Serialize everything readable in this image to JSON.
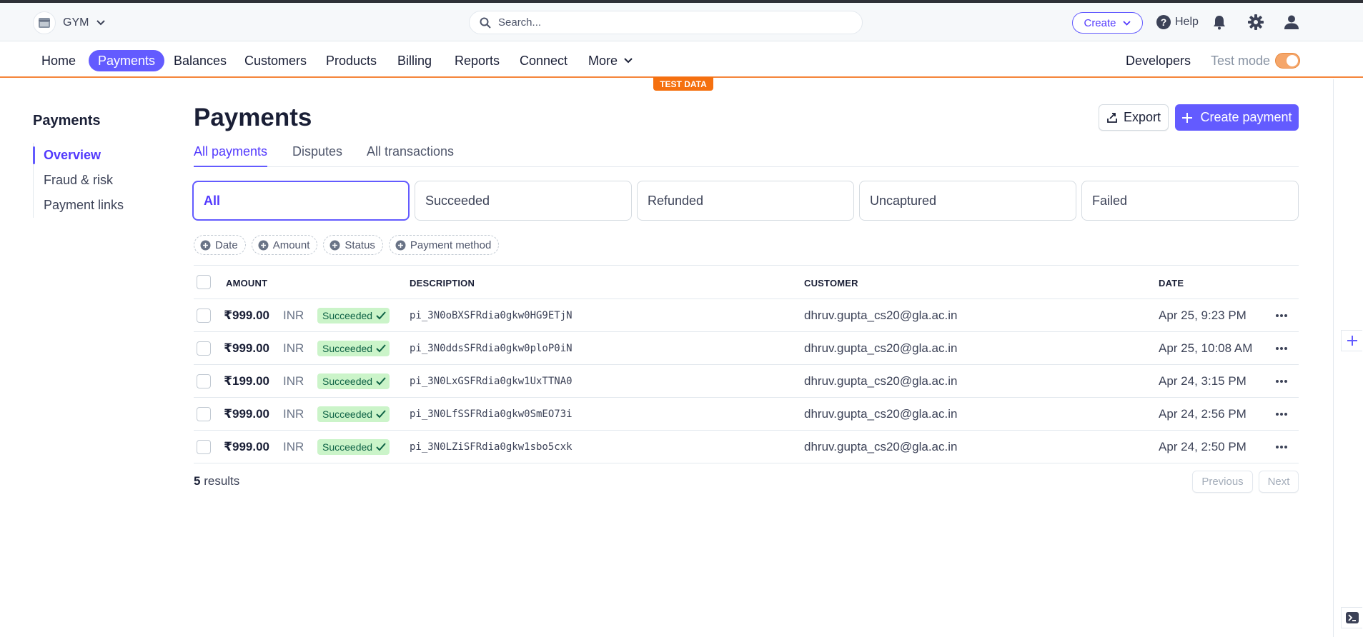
{
  "header": {
    "account_name": "GYM",
    "search_placeholder": "Search...",
    "create_label": "Create",
    "help_label": "Help"
  },
  "nav": {
    "items": [
      "Home",
      "Payments",
      "Balances",
      "Customers",
      "Products",
      "Billing",
      "Reports",
      "Connect",
      "More"
    ],
    "active": "Payments",
    "developers_label": "Developers",
    "test_mode_label": "Test mode",
    "test_mode_on": true,
    "test_data_badge": "TEST DATA"
  },
  "sidebar": {
    "title": "Payments",
    "items": [
      "Overview",
      "Fraud & risk",
      "Payment links"
    ],
    "active": "Overview"
  },
  "main": {
    "title": "Payments",
    "export_label": "Export",
    "create_payment_label": "Create payment",
    "tabs": [
      "All payments",
      "Disputes",
      "All transactions"
    ],
    "active_tab": "All payments",
    "status_filters": [
      "All",
      "Succeeded",
      "Refunded",
      "Uncaptured",
      "Failed"
    ],
    "active_filter": "All",
    "filter_chips": [
      "Date",
      "Amount",
      "Status",
      "Payment method"
    ]
  },
  "table": {
    "columns": [
      "AMOUNT",
      "DESCRIPTION",
      "CUSTOMER",
      "DATE"
    ],
    "rows": [
      {
        "amount": "₹999.00",
        "currency": "INR",
        "status": "Succeeded",
        "description": "pi_3N0oBXSFRdia0gkw0HG9ETjN",
        "customer": "dhruv.gupta_cs20@gla.ac.in",
        "date": "Apr 25, 9:23 PM"
      },
      {
        "amount": "₹999.00",
        "currency": "INR",
        "status": "Succeeded",
        "description": "pi_3N0ddsSFRdia0gkw0ploP0iN",
        "customer": "dhruv.gupta_cs20@gla.ac.in",
        "date": "Apr 25, 10:08 AM"
      },
      {
        "amount": "₹199.00",
        "currency": "INR",
        "status": "Succeeded",
        "description": "pi_3N0LxGSFRdia0gkw1UxTTNA0",
        "customer": "dhruv.gupta_cs20@gla.ac.in",
        "date": "Apr 24, 3:15 PM"
      },
      {
        "amount": "₹999.00",
        "currency": "INR",
        "status": "Succeeded",
        "description": "pi_3N0LfSSFRdia0gkw0SmEO73i",
        "customer": "dhruv.gupta_cs20@gla.ac.in",
        "date": "Apr 24, 2:56 PM"
      },
      {
        "amount": "₹999.00",
        "currency": "INR",
        "status": "Succeeded",
        "description": "pi_3N0LZiSFRdia0gkw1sbo5cxk",
        "customer": "dhruv.gupta_cs20@gla.ac.in",
        "date": "Apr 24, 2:50 PM"
      }
    ]
  },
  "footer": {
    "result_count": "5",
    "results_label": "results",
    "previous_label": "Previous",
    "next_label": "Next"
  },
  "colors": {
    "accent": "#635bff",
    "test_mode": "#f5700f",
    "success_bg": "#cbf4c9",
    "success_text": "#0e6245"
  },
  "icons": {
    "account": "store-icon",
    "search": "search-icon",
    "help": "help-circle-icon",
    "notifications": "bell-icon",
    "settings": "gear-icon",
    "profile": "user-icon",
    "export": "export-icon",
    "create": "plus-icon",
    "status": "checkmark-icon",
    "row_menu": "ellipsis-icon",
    "shell": "terminal-icon"
  }
}
